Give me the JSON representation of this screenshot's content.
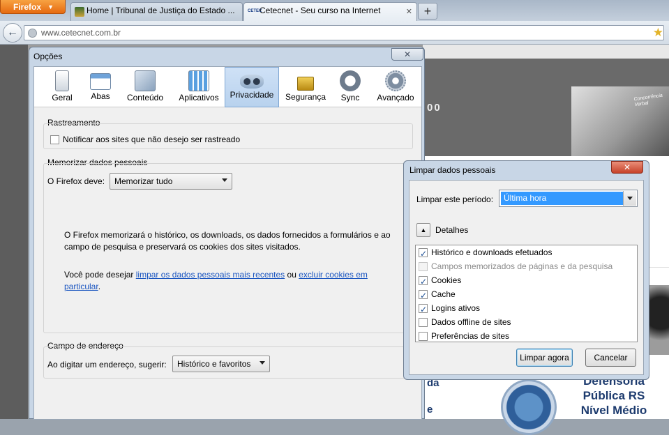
{
  "browser": {
    "menu_button": "Firefox",
    "tabs": [
      {
        "title": "Home | Tribunal de Justiça do Estado ...",
        "active": false
      },
      {
        "title": "Cetecnet - Seu curso na Internet",
        "active": true
      }
    ],
    "new_tab": "+",
    "url": "www.cetecnet.com.br"
  },
  "page": {
    "partial_heading": "00",
    "side_bits": "da\n\ne",
    "defensoria_lines": [
      "Defensoria",
      "Pública RS",
      "Nível Médio"
    ],
    "photo_caption": "Concorrência Verbal"
  },
  "options_dialog": {
    "title": "Opções",
    "close": "✕",
    "toolbar": [
      {
        "label": "Geral",
        "icon": "general-icon"
      },
      {
        "label": "Abas",
        "icon": "tabs-icon"
      },
      {
        "label": "Conteúdo",
        "icon": "content-icon"
      },
      {
        "label": "Aplicativos",
        "icon": "applications-icon"
      },
      {
        "label": "Privacidade",
        "icon": "privacy-mask-icon",
        "selected": true
      },
      {
        "label": "Segurança",
        "icon": "lock-icon"
      },
      {
        "label": "Sync",
        "icon": "sync-icon"
      },
      {
        "label": "Avançado",
        "icon": "gear-icon"
      }
    ],
    "tracking": {
      "legend": "Rastreamento",
      "checkbox": "Notificar aos sites que não desejo ser rastreado"
    },
    "history": {
      "legend": "Memorizar dados pessoais",
      "label": "O Firefox deve:",
      "select": "Memorizar tudo",
      "description": "O Firefox memorizará o histórico, os downloads, os dados fornecidos a formulários e ao campo de pesquisa e preservará os cookies dos sites visitados.",
      "hint_prefix": "Você pode desejar ",
      "link1": "limpar os dados pessoais mais recentes",
      "hint_middle": " ou ",
      "link2": "excluir cookies em particular",
      "hint_suffix": "."
    },
    "location": {
      "legend": "Campo de endereço",
      "label": "Ao digitar um endereço, sugerir:",
      "select": "Histórico e favoritos"
    }
  },
  "clear_dialog": {
    "title": "Limpar dados pessoais",
    "close": "✕",
    "period_label": "Limpar este período:",
    "period_value": "Última hora",
    "details_label": "Detalhes",
    "items": [
      {
        "label": "Histórico e downloads efetuados",
        "checked": true,
        "enabled": true
      },
      {
        "label": "Campos memorizados de páginas e da pesquisa",
        "checked": false,
        "enabled": false
      },
      {
        "label": "Cookies",
        "checked": true,
        "enabled": true
      },
      {
        "label": "Cache",
        "checked": true,
        "enabled": true
      },
      {
        "label": "Logins ativos",
        "checked": true,
        "enabled": true
      },
      {
        "label": "Dados offline de sites",
        "checked": false,
        "enabled": true
      },
      {
        "label": "Preferências de sites",
        "checked": false,
        "enabled": true
      }
    ],
    "clear_button": "Limpar agora",
    "cancel_button": "Cancelar"
  }
}
